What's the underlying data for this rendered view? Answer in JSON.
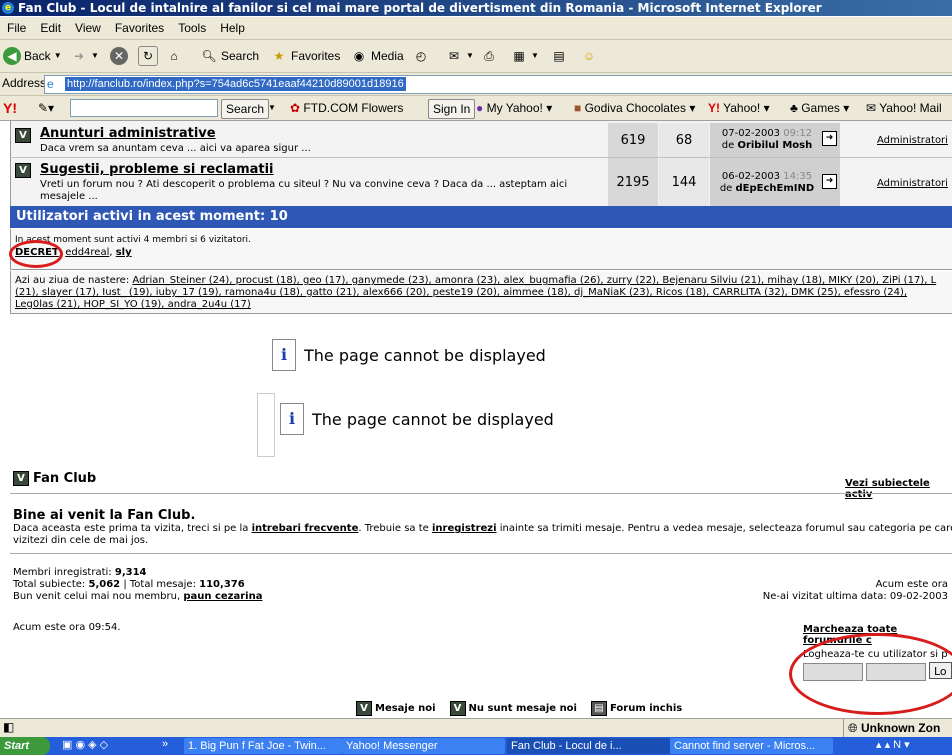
{
  "window": {
    "title": "Fan Club - Locul de intalnire al fanilor si cel mai mare portal de divertisment din Romania - Microsoft Internet Explorer"
  },
  "menu": [
    "File",
    "Edit",
    "View",
    "Favorites",
    "Tools",
    "Help"
  ],
  "toolbar": {
    "back": "Back",
    "search": "Search",
    "favorites": "Favorites",
    "media": "Media"
  },
  "address": {
    "label": "Address",
    "url": "http://fanclub.ro/index.php?s=754ad6c5741eaaf44210d89001d18916"
  },
  "yahoo": {
    "search_button": "Search",
    "ftd": "FTD.COM Flowers",
    "signin": "Sign In",
    "myyahoo": "My Yahoo!",
    "godiva": "Godiva Chocolates",
    "yahoo": "Yahoo!",
    "games": "Games",
    "mail": "Yahoo! Mail"
  },
  "forums": [
    {
      "title": "Anunturi administrative",
      "desc": "Daca vrem sa anuntam ceva ... aici va aparea sigur ...",
      "topics": "619",
      "posts": "68",
      "date": "07-02-2003",
      "time": "09:12",
      "by_prefix": "de",
      "by": "Oribilul Mosh",
      "mod": "Administratori"
    },
    {
      "title": "Sugestii, probleme si reclamatii",
      "desc": "Vreti un forum nou ? Ati descoperit o problema cu siteul ? Nu va convine ceva ? Daca da ... asteptam aici mesajele ...",
      "topics": "2195",
      "posts": "144",
      "date": "06-02-2003",
      "time": "14:35",
      "by_prefix": "de",
      "by": "dEpEchEmIND",
      "mod": "Administratori"
    }
  ],
  "active": {
    "header": "Utilizatori activi in acest moment: 10",
    "summary": "In acest moment sunt activi 4 membri si 6 vizitatori.",
    "members": [
      "DECRET",
      "edd4real",
      "sly"
    ],
    "bday_prefix": "Azi au ziua de nastere:",
    "bday_line1": "Adrian_Steiner (24), procust (18), geo (17), ganymede (23), amonra (23), alex_bugmafia (26), zurry (22), Bejenaru Silviu (21), mihay (18), MIKY (20), ZiPi (17), L",
    "bday_line2": "(21), slayer (17), Iust_ (19), iuby_17 (19), ramona4u (18), gatto (21), alex666 (20), peste19 (20), aimmee (18), dj_MaNiaK (23), Ricos (18), CARRLITA (32), DMK (25), efessro (24),",
    "bday_line3": "Leg0las (21), HOP_SI_YO (19), andra_2u4u (17)"
  },
  "errors": [
    "The page cannot be displayed",
    "The page cannot be displayed"
  ],
  "footer": {
    "brand": "Fan Club",
    "view_new": "Vezi subiectele activ",
    "welcome": "Bine ai venit la Fan Club.",
    "intro_1": "Daca aceasta este prima ta vizita, treci si pe la",
    "intro_link1": "intrebari frecvente",
    "intro_2": ". Trebuie sa te",
    "intro_link2": "inregistrezi",
    "intro_3": "inainte sa trimiti mesaje. Pentru a vedea mesaje, selecteaza forumul sau categoria pe care vre",
    "intro_4": "vizitezi din cele de mai jos.",
    "members_label": "Membri inregistrati:",
    "members_count": "9,314",
    "topics_label": "Total subiecte:",
    "topics_count": "5,062",
    "posts_label": "| Total mesaje:",
    "posts_count": "110,376",
    "newest_label": "Bun venit celui mai nou membru,",
    "newest_member": "paun cezarina",
    "now_label_right": "Acum este ora",
    "last_visit": "Ne-ai vizitat ultima data: 09-02-2003",
    "now_time": "Acum este ora 09:54.",
    "mark_read": "Marcheaza toate forumurile c",
    "login_prompt": "Logheaza-te cu utilizator si p",
    "login_button": "Lo",
    "legend_new": "Mesaje noi",
    "legend_none": "Nu sunt mesaje noi",
    "legend_closed": "Forum inchis"
  },
  "status": {
    "zone": "Unknown Zon"
  },
  "taskbar": {
    "start": "Start",
    "tasks": [
      "1. Big Pun f Fat Joe - Twin...",
      "Yahoo! Messenger",
      "Fan Club - Locul de i...",
      "Cannot find server - Micros..."
    ]
  }
}
